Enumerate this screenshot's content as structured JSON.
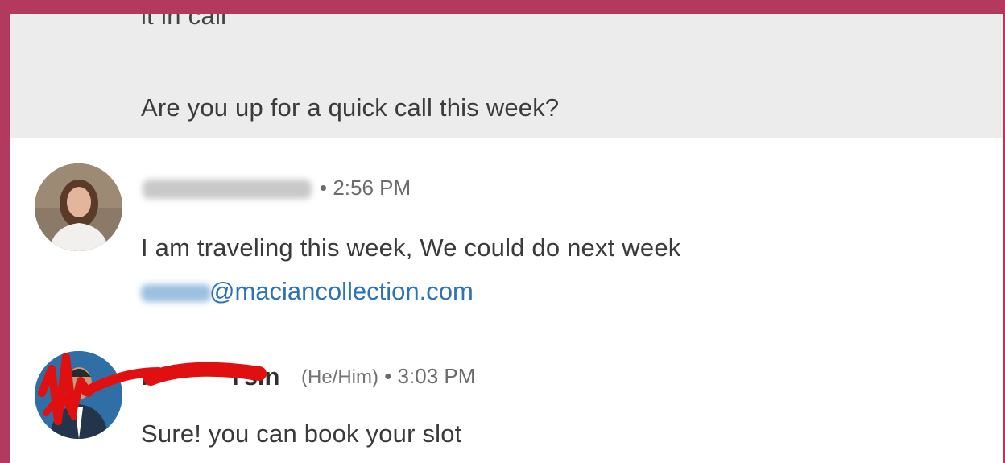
{
  "thread": {
    "quoted": {
      "cut_line": "it in call",
      "question": "Are you up for a quick call this week?"
    },
    "messages": [
      {
        "time": "• 2:56 PM",
        "lines": [
          "I am traveling this week, We could do next week"
        ],
        "email_suffix": "@maciancollection.com"
      },
      {
        "name_visible": "sin",
        "name_prefix_visible": "F",
        "name_mid_visible": "Y",
        "pronouns": "(He/Him)",
        "time": "• 3:03 PM",
        "lines": [
          "Sure! you can book your slot"
        ]
      }
    ]
  },
  "colors": {
    "frame": "#b3395f",
    "quoted_bg": "#ececec",
    "link": "#2b72b6",
    "redaction": "#e01010"
  }
}
